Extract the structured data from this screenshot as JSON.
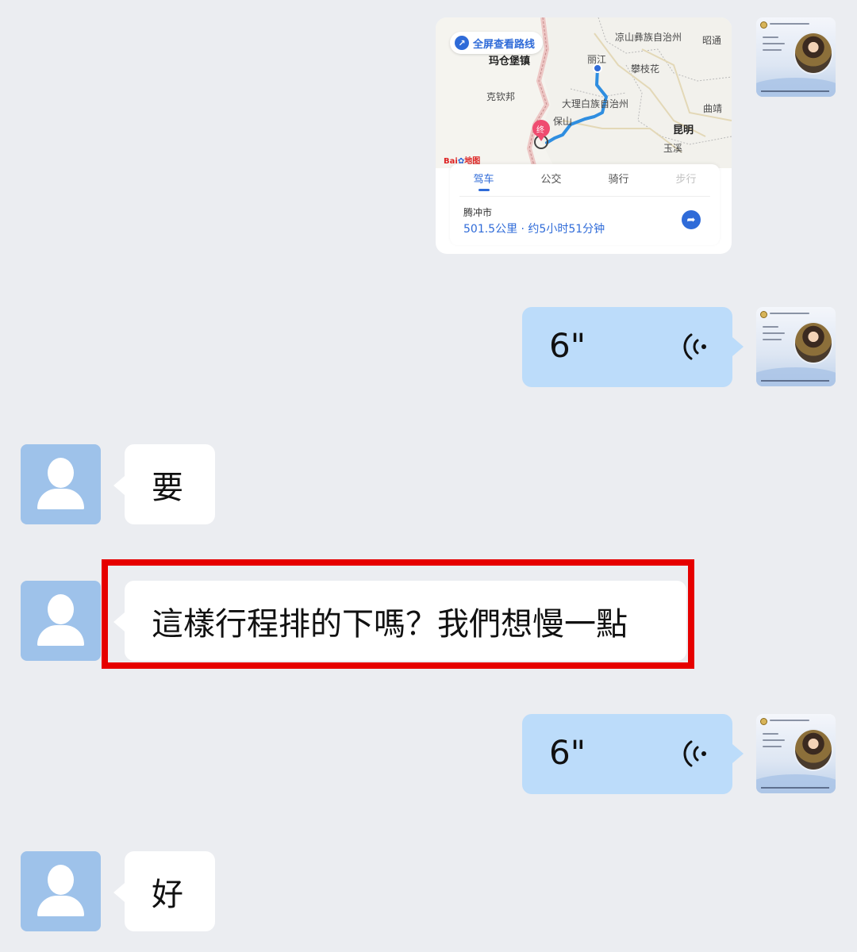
{
  "map_message": {
    "fullscreen_label": "全屏查看路线",
    "place_labels": [
      "凉山彝族自治州",
      "昭通",
      "丽江",
      "玛仓堡镇",
      "攀枝花",
      "克钦邦",
      "大理白族自治州",
      "曲靖",
      "保山",
      "昆明",
      "玉溪"
    ],
    "end_marker": "终",
    "map_brand": "Bai",
    "map_brand_suffix": "地图",
    "tabs": [
      {
        "label": "驾车",
        "state": "active"
      },
      {
        "label": "公交",
        "state": "normal"
      },
      {
        "label": "骑行",
        "state": "normal"
      },
      {
        "label": "步行",
        "state": "disabled"
      }
    ],
    "destination": "腾冲市",
    "route_summary": "501.5公里 · 约5小时51分钟",
    "nav_icon": "route-arrow-icon"
  },
  "messages": [
    {
      "type": "voice",
      "direction": "out",
      "duration": "6\""
    },
    {
      "type": "text",
      "direction": "in",
      "text": "要"
    },
    {
      "type": "text",
      "direction": "in",
      "text": "這樣行程排的下嗎？我們想慢一點"
    },
    {
      "type": "voice",
      "direction": "out",
      "duration": "6\""
    },
    {
      "type": "text",
      "direction": "in",
      "text": "好"
    }
  ],
  "colors": {
    "background": "#ebedf1",
    "outgoing_bubble": "#bcdcfa",
    "incoming_bubble": "#ffffff",
    "highlight": "#e60000",
    "accent": "#2f6bd8"
  }
}
